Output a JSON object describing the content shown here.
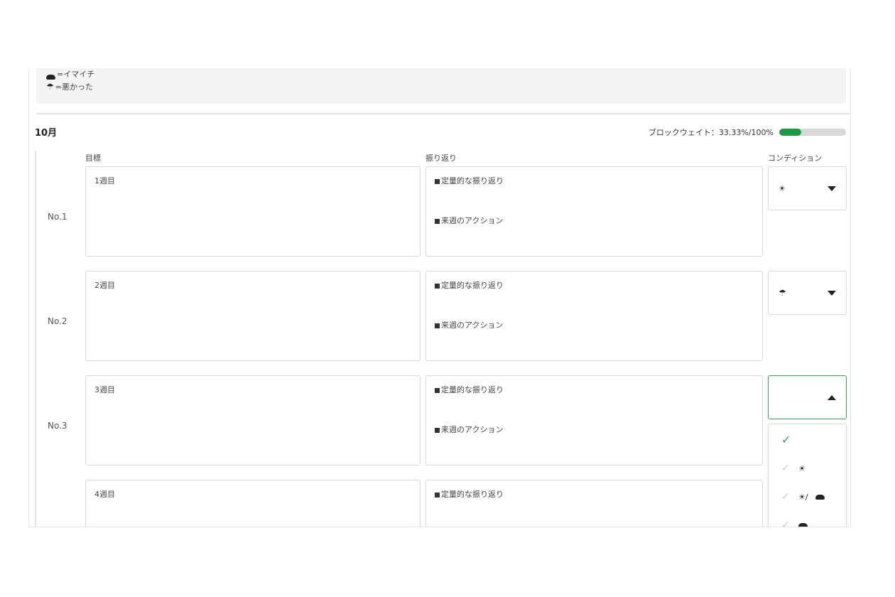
{
  "legend": {
    "items": [
      {
        "icon": "cloud-icon",
        "text": "=イマイチ"
      },
      {
        "icon": "umbrella-icon",
        "text": "=悪かった"
      }
    ]
  },
  "month": {
    "title": "10月",
    "weight_label": "ブロックウェイト：33.33%/100%",
    "weight_progress": 0.3333,
    "accent_color": "#1e9a46"
  },
  "columns": {
    "goal": "目標",
    "reflection": "振り返り",
    "condition": "コンディション"
  },
  "rows": [
    {
      "label": "No.1",
      "goal": "1週目",
      "refl1": "定量的な振り返り",
      "refl2": "来週のアクション",
      "condition": "☀"
    },
    {
      "label": "No.2",
      "goal": "2週目",
      "refl1": "定量的な振り返り",
      "refl2": "来週のアクション",
      "condition": "☂"
    },
    {
      "label": "No.3",
      "goal": "3週目",
      "refl1": "定量的な振り返り",
      "refl2": "来週のアクション",
      "condition": ""
    },
    {
      "label": "",
      "goal": "4週目",
      "refl1": "定量的な振り返り",
      "refl2": "",
      "condition": ""
    }
  ],
  "dropdown": {
    "options": [
      {
        "text": "",
        "selected": true
      },
      {
        "text": "☀",
        "selected": false
      },
      {
        "text": "☀/",
        "icon": "cloud-icon",
        "selected": false
      },
      {
        "text": "",
        "icon": "cloud-icon",
        "selected": false
      }
    ]
  }
}
